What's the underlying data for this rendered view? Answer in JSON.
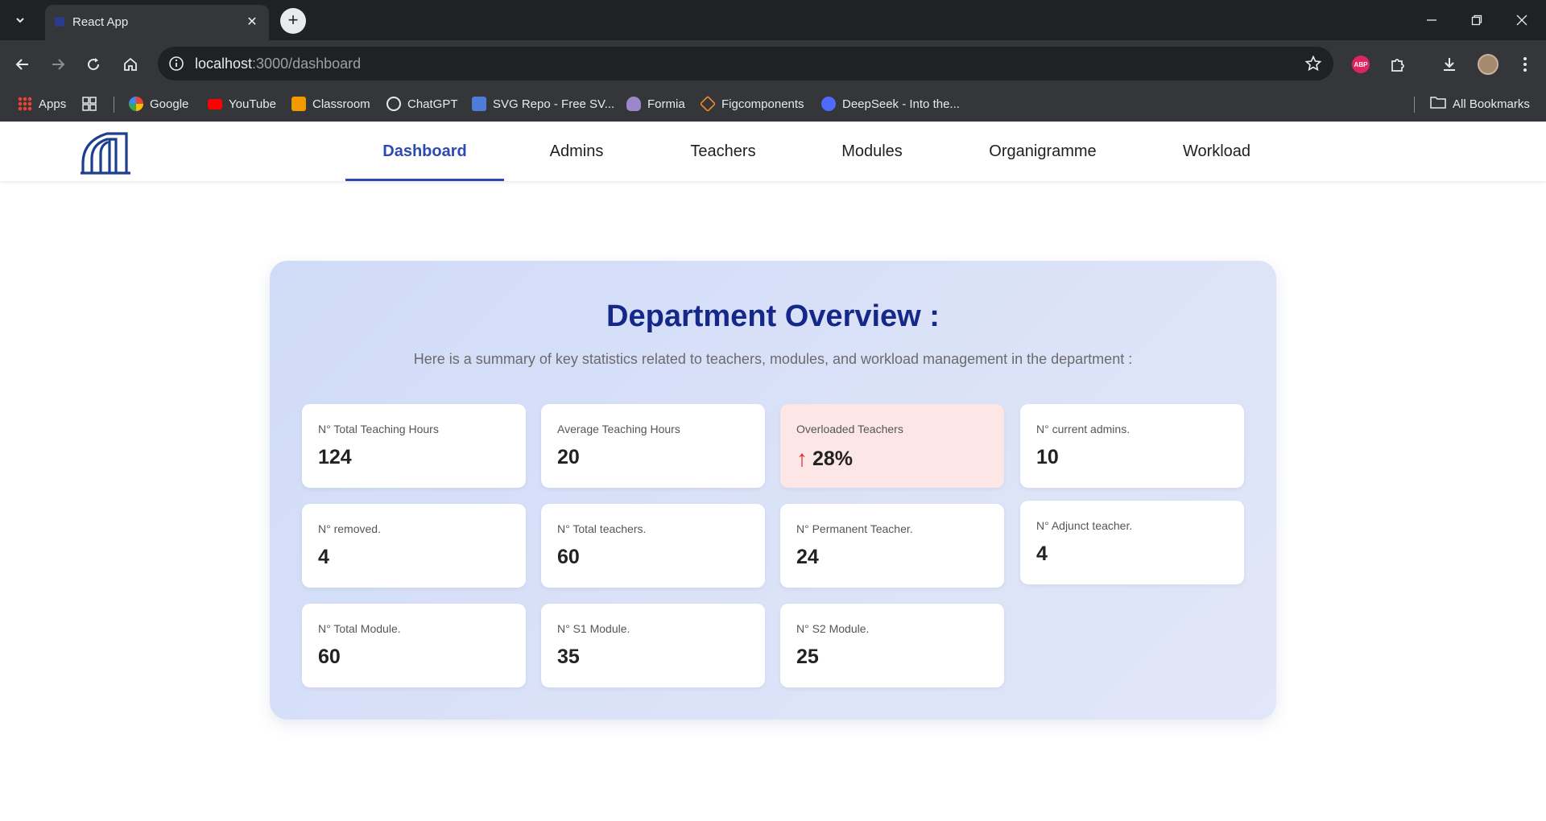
{
  "browser": {
    "tab_title": "React App",
    "url_host": "localhost",
    "url_rest": ":3000/dashboard",
    "bookmarks": [
      {
        "label": "Apps",
        "icon": "apps-grid-icon"
      },
      {
        "label": "Google",
        "icon": "google-icon"
      },
      {
        "label": "YouTube",
        "icon": "youtube-icon"
      },
      {
        "label": "Classroom",
        "icon": "classroom-icon"
      },
      {
        "label": "ChatGPT",
        "icon": "chatgpt-icon"
      },
      {
        "label": "SVG Repo - Free SV...",
        "icon": "svgrepo-icon"
      },
      {
        "label": "Formia",
        "icon": "formia-icon"
      },
      {
        "label": "Figcomponents",
        "icon": "figcomponents-icon"
      },
      {
        "label": "DeepSeek - Into the...",
        "icon": "deepseek-icon"
      }
    ],
    "all_bookmarks": "All Bookmarks",
    "abp_label": "ABP"
  },
  "nav": {
    "items": [
      "Dashboard",
      "Admins",
      "Teachers",
      "Modules",
      "Organigramme",
      "Workload"
    ],
    "active": "Dashboard"
  },
  "overview": {
    "title": "Department Overview :",
    "subtitle": "Here is a summary of key statistics related to teachers, modules, and workload management in the department :",
    "stats": [
      {
        "label": "N° Total Teaching Hours",
        "value": "124"
      },
      {
        "label": "Average Teaching Hours",
        "value": "20"
      },
      {
        "label": "Overloaded Teachers",
        "value": "28%",
        "trend": "up",
        "arrow": "↑"
      },
      {
        "label": "N° current admins.",
        "value": "10"
      },
      {
        "label": "N° removed.",
        "value": "4"
      },
      {
        "label": "N° Total teachers.",
        "value": "60"
      },
      {
        "label": "N° Permanent Teacher.",
        "value": "24"
      },
      {
        "label": "N° Adjunct teacher.",
        "value": "4"
      },
      {
        "label": "N° Total Module.",
        "value": "60"
      },
      {
        "label": "N° S1 Module.",
        "value": "35"
      },
      {
        "label": "N° S2 Module.",
        "value": "25"
      }
    ]
  },
  "colors": {
    "accent": "#2b4bb1",
    "title": "#15288a",
    "warn_bg": "#fde6e6",
    "trend_up": "#e02424"
  }
}
